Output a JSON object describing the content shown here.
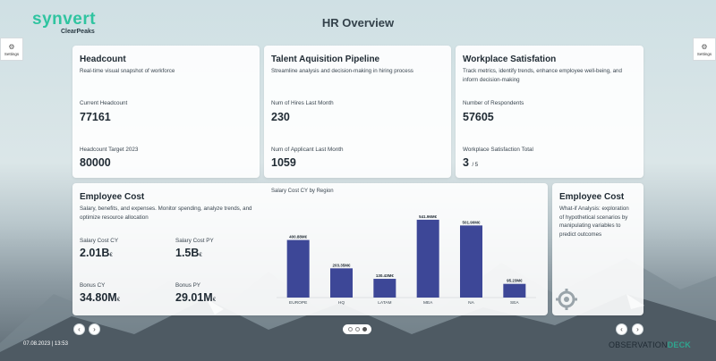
{
  "app": {
    "brand": "synvert",
    "sub": "ClearPeaks",
    "title": "HR Overview"
  },
  "settings": {
    "left_label": "Settings",
    "right_label": "Settings"
  },
  "headcount": {
    "title": "Headcount",
    "desc": "Real-time visual snapshot of workforce",
    "current_label": "Current Headcount",
    "current_value": "77161",
    "target_label": "Headcount Target 2023",
    "target_value": "80000"
  },
  "talent": {
    "title": "Talent Aquisition Pipeline",
    "desc": "Streamline analysis and decision-making in hiring process",
    "hires_label": "Num of Hires Last Month",
    "hires_value": "230",
    "applicants_label": "Num of Applicant Last Month",
    "applicants_value": "1059"
  },
  "satisfaction": {
    "title": "Workplace Satisfation",
    "desc": "Track metrics, identify trends, enhance employee well-being, and inform decision-making",
    "respondents_label": "Number of Respondents",
    "respondents_value": "57605",
    "total_label": "Workplace Satisfaction Total",
    "total_value": "3",
    "total_scale": "/ 5"
  },
  "cost": {
    "title": "Employee Cost",
    "desc": "Salary, benefits, and expenses. Monitor spending, analyze trends, and optimize resource allocation",
    "salary_cy_label": "Salary Cost CY",
    "salary_cy_value": "2.01B",
    "salary_cy_unit": "€",
    "salary_py_label": "Salary Cost PY",
    "salary_py_value": "1.5B",
    "salary_py_unit": "€",
    "bonus_cy_label": "Bonus CY",
    "bonus_cy_value": "34.80M",
    "bonus_cy_unit": "€",
    "bonus_py_label": "Bonus PY",
    "bonus_py_value": "29.01M",
    "bonus_py_unit": "€"
  },
  "chart_data": {
    "type": "bar",
    "title": "Salary Cost CY by Region",
    "categories": [
      "EUROPE",
      "HQ",
      "LATAM",
      "MEA",
      "NA",
      "SEA"
    ],
    "values": [
      400.88,
      203.35,
      130.43,
      541.96,
      501.9,
      95.23
    ],
    "data_labels": [
      "400.88M€",
      "203.35M€",
      "130.43M€",
      "541.96M€",
      "501.90M€",
      "95.23M€"
    ],
    "ylim": [
      0,
      560
    ],
    "bar_color": "#3d4797",
    "grid": false
  },
  "whatif": {
    "title": "Employee Cost",
    "desc": "What-if Analysis: exploration of hypothetical scenarios by manipulating variables to predict outcomes"
  },
  "footer": {
    "datetime": "07.08.2023 | 13:53",
    "deck_a": "OBSERVATION",
    "deck_b": "DECK"
  },
  "nav": {
    "prev": "‹",
    "next": "›"
  },
  "colors": {
    "accent": "#2fc4a0",
    "bar": "#3d4797"
  }
}
